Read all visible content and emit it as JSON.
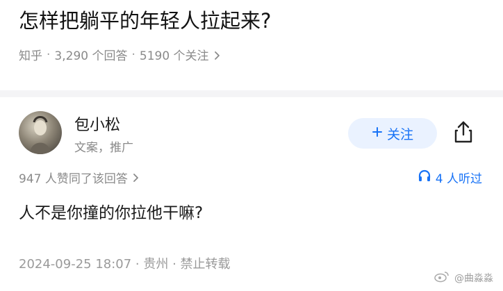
{
  "question": {
    "title": "怎样把躺平的年轻人拉起来?",
    "source": "知乎",
    "answers": "3,290 个回答",
    "followers": "5190 个关注"
  },
  "author": {
    "name": "包小松",
    "tags": "文案，推广",
    "follow_label": "关注"
  },
  "answer": {
    "votes_text": "947 人赞同了该回答",
    "listened_text": "4 人听过",
    "content": "人不是你撞的你拉他干嘛?",
    "footer": "2024-09-25 18:07 · 贵州 · 禁止转载"
  },
  "watermark": {
    "text": "@曲淼淼"
  },
  "colors": {
    "accent": "#1772f6",
    "follow_bg": "#eaf2ff",
    "meta_gray": "#8a8a8a"
  }
}
